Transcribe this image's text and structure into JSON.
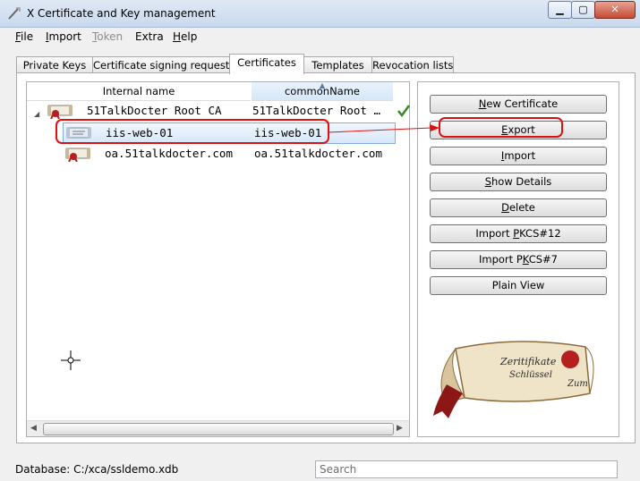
{
  "window": {
    "title": "X Certificate and Key management",
    "buttons": {
      "minimize": "▁",
      "maximize": "▢",
      "close": "✕"
    }
  },
  "menu": [
    {
      "label": "File",
      "accel": "F",
      "rest": "ile",
      "disabled": false
    },
    {
      "label": "Import",
      "accel": "I",
      "rest": "mport",
      "disabled": false
    },
    {
      "label": "Token",
      "accel": "T",
      "rest": "oken",
      "disabled": true
    },
    {
      "label": "Extra",
      "accel": "",
      "rest": "Extra",
      "disabled": false
    },
    {
      "label": "Help",
      "accel": "H",
      "rest": "elp",
      "disabled": false
    }
  ],
  "tabs": [
    "Private Keys",
    "Certificate signing requests",
    "Certificates",
    "Templates",
    "Revocation lists"
  ],
  "active_tab": "Certificates",
  "table": {
    "columns": [
      "Internal name",
      "commonName"
    ],
    "sorted_column": "commonName",
    "rows": [
      {
        "internal_name": "51TalkDocter Root CA",
        "common_name": "51TalkDocter Root …",
        "trusted": true,
        "expanded": true
      },
      {
        "internal_name": "iis-web-01",
        "common_name": "iis-web-01",
        "selected": true
      },
      {
        "internal_name": "oa.51talkdocter.com",
        "common_name": "oa.51talkdocter.com"
      }
    ]
  },
  "buttons": {
    "new_certificate": {
      "accel": "N",
      "rest": "ew Certificate"
    },
    "export": {
      "accel": "E",
      "rest": "xport"
    },
    "import": {
      "accel": "I",
      "rest": "mport"
    },
    "show_details": {
      "accel": "S",
      "rest": "how Details"
    },
    "delete": {
      "accel": "D",
      "rest": "elete"
    },
    "import_pkcs12": {
      "pre": "Import ",
      "accel": "P",
      "rest": "KCS#12"
    },
    "import_pkcs7": {
      "pre": "Import P",
      "accel": "K",
      "rest": "CS#7"
    },
    "plain_view": {
      "label": "Plain View"
    }
  },
  "logo_text": {
    "line1": "Zeritifikate",
    "line2": "Schlüssel",
    "line3": "Zum"
  },
  "status": {
    "database": "Database: C:/xca/ssldemo.xdb"
  },
  "search": {
    "placeholder": "Search"
  },
  "colors": {
    "annotation": "#e01010",
    "accent": "#3a8a1f",
    "selection": "#d6e7f8"
  }
}
